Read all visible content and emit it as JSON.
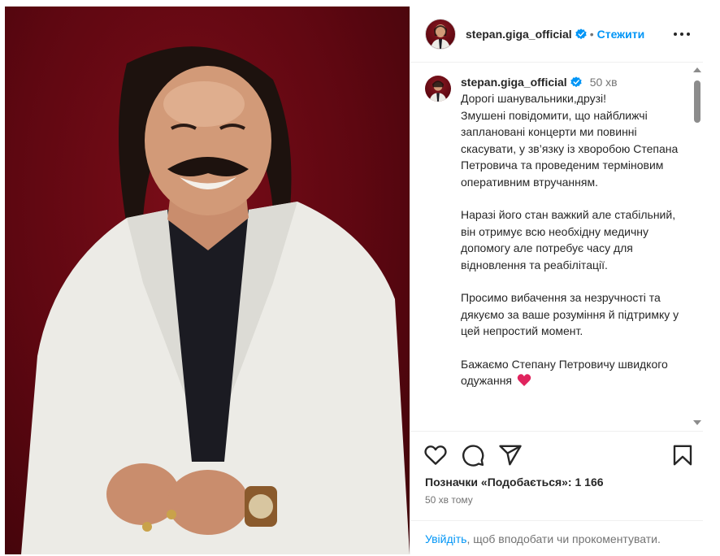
{
  "post": {
    "username": "stepan.giga_official",
    "separator": "•",
    "follow_label": "Стежити",
    "time_short": "50 хв",
    "caption_paragraphs": [
      [
        "Дорогі шанувальники,друзі!",
        "Змушені повідомити, що найближчі заплановані концерти ми повинні скасувати, у зв’язку із хворобою Степана Петровича та проведеним терміновим оперативним втручанням."
      ],
      [
        "Наразі його стан важкий але стабільний, він отримує всю необхідну медичну допомогу але потребує часу для відновлення та реабілітації."
      ],
      [
        "Просимо вибачення за незручності та дякуємо за ваше розуміння й підтримку у цей непростий момент."
      ],
      [
        "Бажаємо Степану Петровичу швидкого одужання"
      ]
    ],
    "likes_text": "Позначки «Подобається»: 1 166",
    "time_ago": "50 хв тому",
    "login_link": "Увійдіть",
    "login_rest": ", щоб вподобати чи прокоментувати."
  },
  "icons": [
    "verified-badge-icon",
    "more-options-icon",
    "like-heart-icon",
    "comment-icon",
    "share-icon",
    "bookmark-icon",
    "red-heart-emoji-icon"
  ],
  "colors": {
    "accent": "#0095f6",
    "text": "#262626",
    "muted": "#737373",
    "photo_bg": "#5e0711",
    "heart": "#e0245e"
  }
}
